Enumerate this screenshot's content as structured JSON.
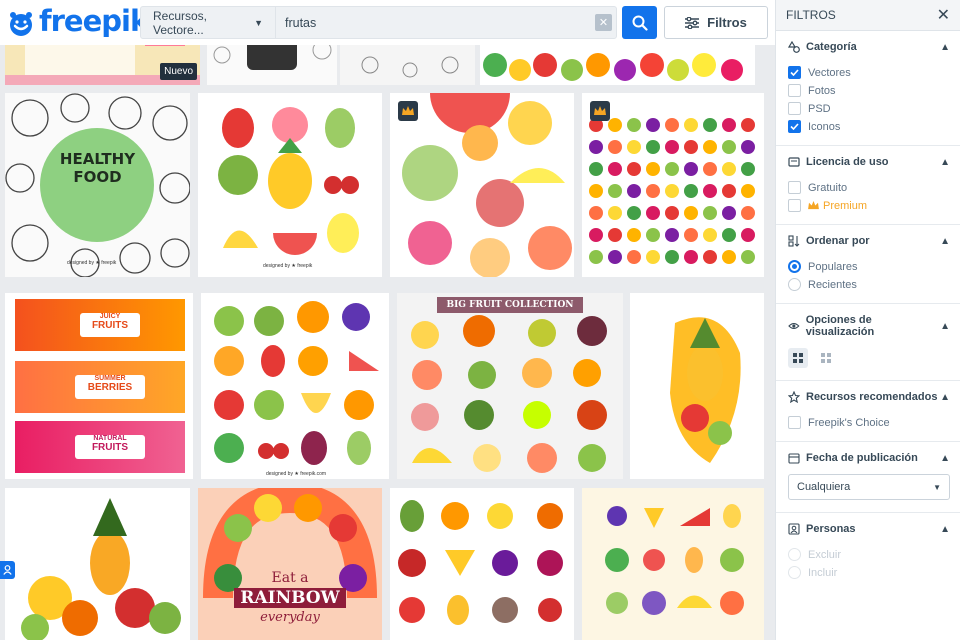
{
  "header": {
    "logo_text": "freepik",
    "search_type": "Recursos, Vectore...",
    "search_value": "frutas",
    "clear_symbol": "✕",
    "filters_label": "Filtros"
  },
  "grid": {
    "new_badge": "Nuevo",
    "tiles": [
      {
        "title_line1": "HEALTHY",
        "title_line2": "FOOD",
        "credit": "designed by ★ freepik"
      },
      {
        "credit": "designed by ★ freepik"
      },
      {
        "premium": true
      },
      {
        "premium": true
      },
      {
        "labels": [
          "JUICY",
          "FRUITS",
          "SUMMER",
          "BERRIES",
          "NATURAL",
          "FRUITS"
        ]
      },
      {
        "credit": "designed by ★ freepik.com"
      },
      {
        "banner": "BIG FRUIT COLLECTION"
      },
      {},
      {},
      {
        "line1": "Eat a",
        "line2": "RAINBOW",
        "line3": "everyday"
      },
      {},
      {}
    ]
  },
  "sidebar": {
    "title": "FILTROS",
    "close_symbol": "✕",
    "category": {
      "title": "Categoría",
      "options": [
        {
          "label": "Vectores",
          "checked": true
        },
        {
          "label": "Fotos",
          "checked": false
        },
        {
          "label": "PSD",
          "checked": false
        },
        {
          "label": "Iconos",
          "checked": true
        }
      ]
    },
    "license": {
      "title": "Licencia de uso",
      "options": [
        {
          "label": "Gratuito",
          "checked": false
        },
        {
          "label": "Premium",
          "checked": false
        }
      ]
    },
    "order": {
      "title": "Ordenar por",
      "options": [
        {
          "label": "Populares",
          "selected": true
        },
        {
          "label": "Recientes",
          "selected": false
        }
      ]
    },
    "view": {
      "title": "Opciones de visualización"
    },
    "recommended": {
      "title": "Recursos recomendados",
      "options": [
        {
          "label": "Freepik's Choice",
          "checked": false
        }
      ]
    },
    "date": {
      "title": "Fecha de publicación",
      "value": "Cualquiera"
    },
    "people": {
      "title": "Personas",
      "options": [
        {
          "label": "Excluir"
        },
        {
          "label": "Incluir"
        }
      ]
    }
  },
  "colors": {
    "brand": "#1273eb",
    "premium": "#f5a524",
    "text": "#374957"
  }
}
